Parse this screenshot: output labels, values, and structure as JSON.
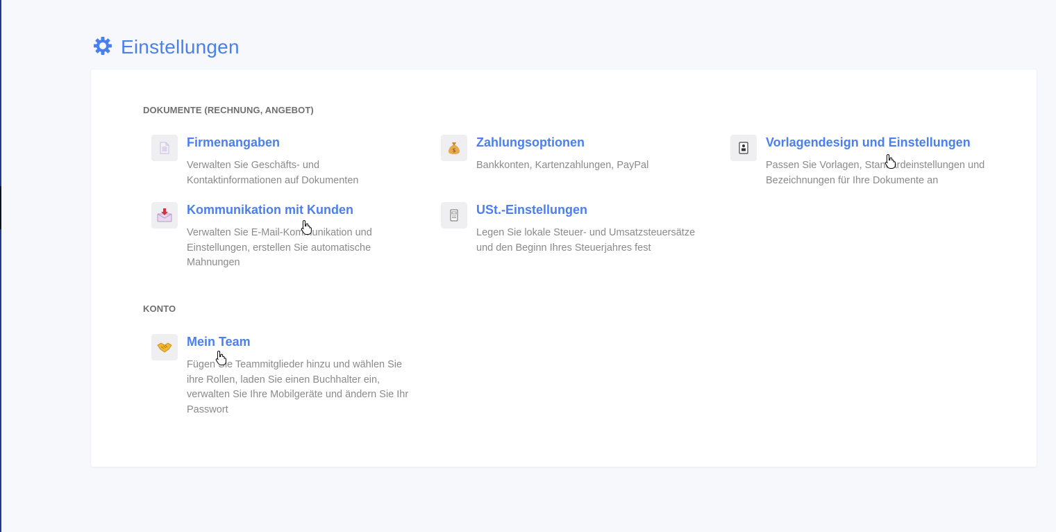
{
  "header": {
    "title": "Einstellungen",
    "icon": "gear-icon",
    "accent": "#4a7ff0"
  },
  "sections": [
    {
      "label": "DOKUMENTE (RECHNUNG, ANGEBOT)",
      "items": [
        {
          "title": "Firmenangaben",
          "description": "Verwalten Sie Geschäfts- und Kontaktinformationen auf Dokumenten",
          "icon": "document-icon"
        },
        {
          "title": "Zahlungsoptionen",
          "description": "Bankkonten, Kartenzahlungen, PayPal",
          "icon": "money-bag-icon"
        },
        {
          "title": "Vorlagendesign und Einstellungen",
          "description": "Passen Sie Vorlagen, Standardeinstellungen und Bezeichnungen für Ihre Dokumente an",
          "icon": "template-icon"
        },
        {
          "title": "Kommunikation mit Kunden",
          "description": "Verwalten Sie E-Mail-Kommunikation und Einstellungen, erstellen Sie automatische Mahnungen",
          "icon": "envelope-download-icon"
        },
        {
          "title": "USt.-Einstellungen",
          "description": "Legen Sie lokale Steuer- und Umsatzsteuersätze und den Beginn Ihres Steuerjahres fest",
          "icon": "tax-form-icon"
        }
      ]
    },
    {
      "label": "KONTO",
      "items": [
        {
          "title": "Mein Team",
          "description": "Fügen Sie Teammitglieder hinzu und wählen Sie ihre Rollen, laden Sie einen Buchhalter ein, verwalten Sie Ihre Mobilgeräte und ändern Sie Ihr Passwort",
          "icon": "handshake-icon"
        }
      ]
    }
  ]
}
